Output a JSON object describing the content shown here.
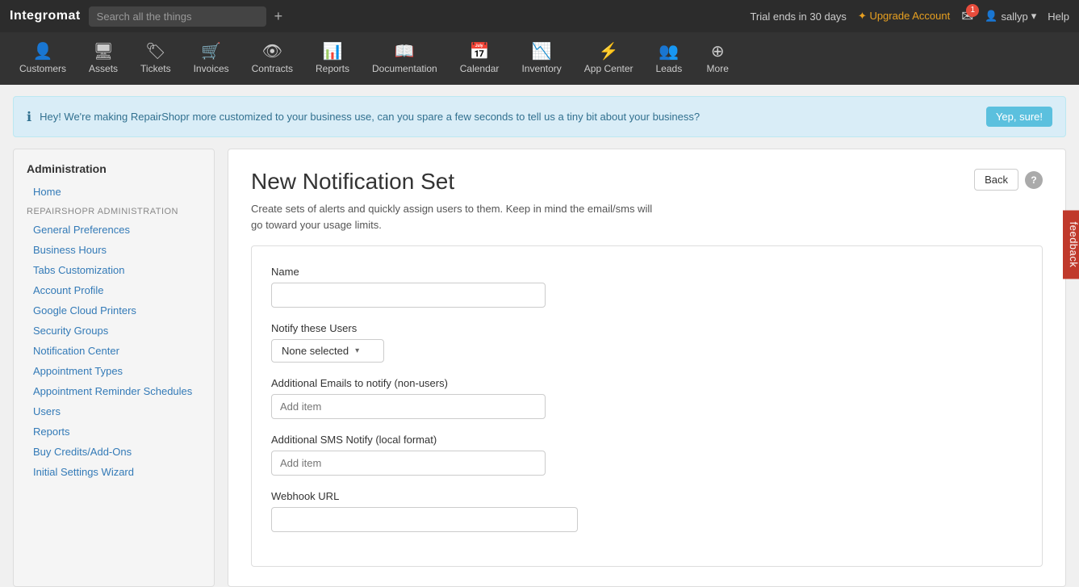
{
  "brand": "Integromat",
  "search": {
    "placeholder": "Search all the things"
  },
  "topbar": {
    "trial": "Trial ends in 30 days",
    "upgrade": "✦ Upgrade Account",
    "mail_badge": "1",
    "user": "sallyp",
    "help": "Help"
  },
  "nav": {
    "items": [
      {
        "id": "customers",
        "label": "Customers",
        "icon": "👤"
      },
      {
        "id": "assets",
        "label": "Assets",
        "icon": "🖥"
      },
      {
        "id": "tickets",
        "label": "Tickets",
        "icon": "🏷"
      },
      {
        "id": "invoices",
        "label": "Invoices",
        "icon": "🛒"
      },
      {
        "id": "contracts",
        "label": "Contracts",
        "icon": "👁"
      },
      {
        "id": "reports",
        "label": "Reports",
        "icon": "📊"
      },
      {
        "id": "documentation",
        "label": "Documentation",
        "icon": "📖"
      },
      {
        "id": "calendar",
        "label": "Calendar",
        "icon": "📅"
      },
      {
        "id": "inventory",
        "label": "Inventory",
        "icon": "📉"
      },
      {
        "id": "app-center",
        "label": "App Center",
        "icon": "⚡"
      },
      {
        "id": "leads",
        "label": "Leads",
        "icon": "👥"
      },
      {
        "id": "more",
        "label": "More",
        "icon": "+"
      }
    ]
  },
  "banner": {
    "text": "Hey! We're making RepairShopr more customized to your business use, can you spare a few seconds to tell us a tiny bit about your business?",
    "button": "Yep, sure!"
  },
  "sidebar": {
    "title": "Administration",
    "section_label": "REPAIRSHOPR ADMINISTRATION",
    "home": "Home",
    "links": [
      "General Preferences",
      "Business Hours",
      "Tabs Customization",
      "Account Profile",
      "Google Cloud Printers",
      "Security Groups",
      "Notification Center",
      "Appointment Types",
      "Appointment Reminder Schedules",
      "Users",
      "Reports",
      "Buy Credits/Add-Ons",
      "Initial Settings Wizard"
    ]
  },
  "page": {
    "title": "New Notification Set",
    "subtitle": "Create sets of alerts and quickly assign users to them. Keep in mind the email/sms will go toward your usage limits.",
    "back_button": "Back",
    "help_symbol": "?"
  },
  "form": {
    "name_label": "Name",
    "name_placeholder": "",
    "notify_label": "Notify these Users",
    "notify_default": "None selected",
    "additional_emails_label": "Additional Emails to notify (non-users)",
    "additional_emails_placeholder": "Add item",
    "additional_sms_label": "Additional SMS Notify (local format)",
    "additional_sms_placeholder": "Add item",
    "webhook_label": "Webhook URL",
    "webhook_placeholder": ""
  },
  "feedback": "feedback"
}
